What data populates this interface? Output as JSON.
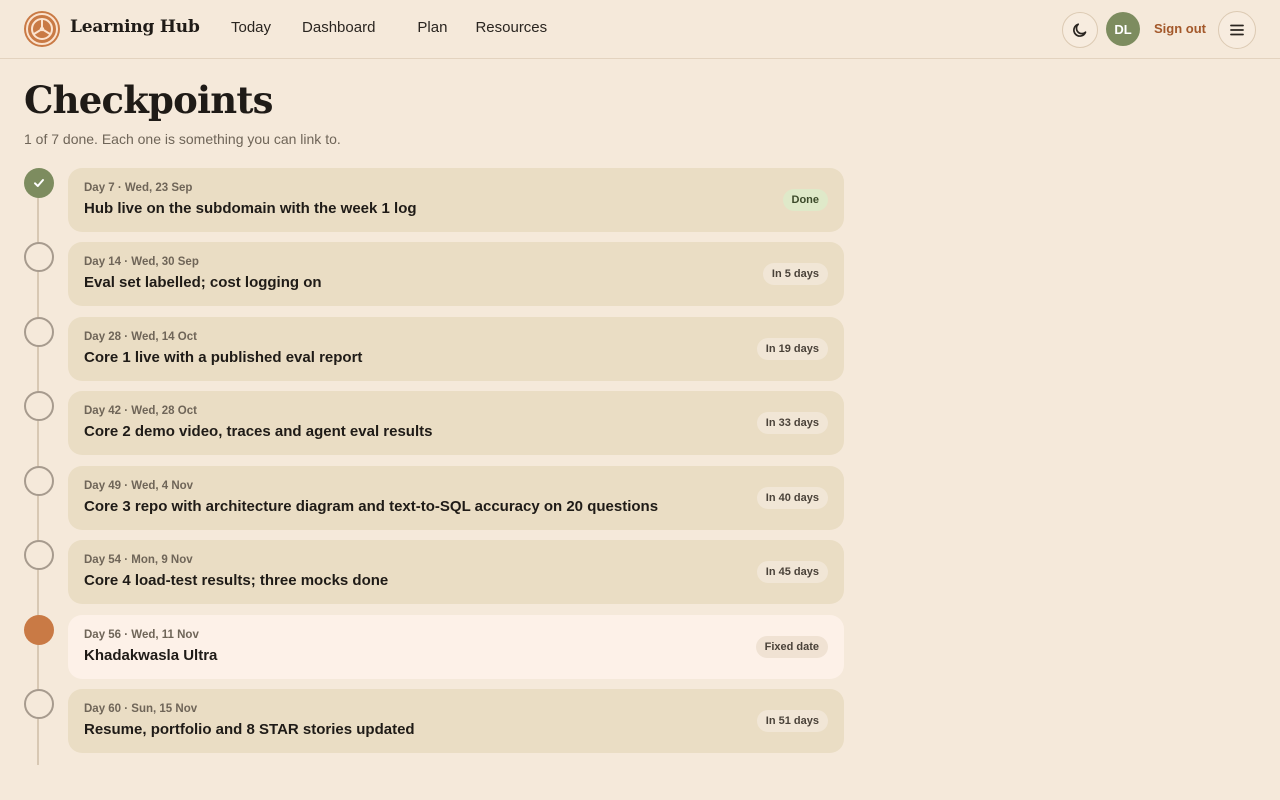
{
  "app": {
    "name": "Learning Hub"
  },
  "nav": {
    "items": [
      "Today",
      "Dashboard",
      "Plan",
      "Resources"
    ]
  },
  "user": {
    "initials": "DL",
    "signout_label": "Sign out"
  },
  "icons": {
    "logo": "learning-hub-logo-icon",
    "theme": "moon-icon",
    "menu": "hamburger-menu-icon",
    "done": "check-icon"
  },
  "colors": {
    "background": "#f5e9da",
    "done": "#7d8c5f",
    "fixed": "#c97a45",
    "accent_text": "#a3582a"
  },
  "page": {
    "title": "Checkpoints",
    "subtitle": "1 of 7 done. Each one is something you can link to."
  },
  "checkpoints": [
    {
      "meta": "Day 7 · Wed, 23 Sep",
      "title": "Hub live on the subdomain with the week 1 log",
      "badge": "Done",
      "state": "done"
    },
    {
      "meta": "Day 14 · Wed, 30 Sep",
      "title": "Eval set labelled; cost logging on",
      "badge": "In 5 days",
      "state": "open"
    },
    {
      "meta": "Day 28 · Wed, 14 Oct",
      "title": "Core 1 live with a published eval report",
      "badge": "In 19 days",
      "state": "open"
    },
    {
      "meta": "Day 42 · Wed, 28 Oct",
      "title": "Core 2 demo video, traces and agent eval results",
      "badge": "In 33 days",
      "state": "open"
    },
    {
      "meta": "Day 49 · Wed, 4 Nov",
      "title": "Core 3 repo with architecture diagram and text-to-SQL accuracy on 20 questions",
      "badge": "In 40 days",
      "state": "open"
    },
    {
      "meta": "Day 54 · Mon, 9 Nov",
      "title": "Core 4 load-test results; three mocks done",
      "badge": "In 45 days",
      "state": "open"
    },
    {
      "meta": "Day 56 · Wed, 11 Nov",
      "title": "Khadakwasla Ultra",
      "badge": "Fixed date",
      "state": "fixed"
    },
    {
      "meta": "Day 60 · Sun, 15 Nov",
      "title": "Resume, portfolio and 8 STAR stories updated",
      "badge": "In 51 days",
      "state": "open"
    }
  ]
}
